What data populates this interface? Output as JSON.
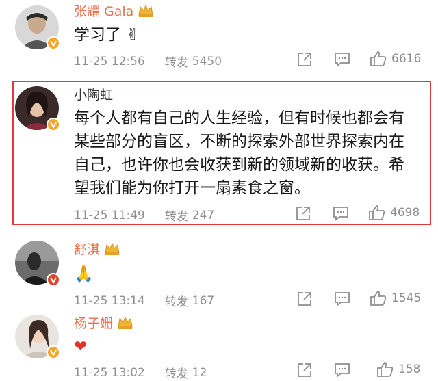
{
  "comments": [
    {
      "name": "张耀 Gala",
      "text": "学习了 ✌",
      "date": "11-25 12:56",
      "repost_label": "转发",
      "reposts": "5450",
      "likes": "6616"
    },
    {
      "name": "小陶虹",
      "text_lines": [
        "每个人都有自己的人生经验，但有时候也都会有",
        "某些部分的盲区，不断的探索外部世界探索内在",
        "自己，也许你也会收获到新的领域新的收获。希",
        "望我们能为你打开一扇素食之窗。"
      ],
      "date": "11-25 11:49",
      "repost_label": "转发",
      "reposts": "247",
      "likes": "4698"
    },
    {
      "name": "舒淇",
      "text": "🙏",
      "date": "11-25 13:14",
      "repost_label": "转发",
      "reposts": "167",
      "likes": "1545"
    },
    {
      "name": "杨子姗",
      "text": "❤",
      "date": "11-25 13:02",
      "repost_label": "转发",
      "reposts": "12",
      "likes": "158"
    }
  ],
  "colors": {
    "vip_name": "#eb7350",
    "highlight_border": "#e03a3a",
    "verified_badge": "#f5a623"
  },
  "icons": [
    "crown-icon",
    "verified-badge-icon",
    "share-icon",
    "comment-icon",
    "like-icon"
  ]
}
